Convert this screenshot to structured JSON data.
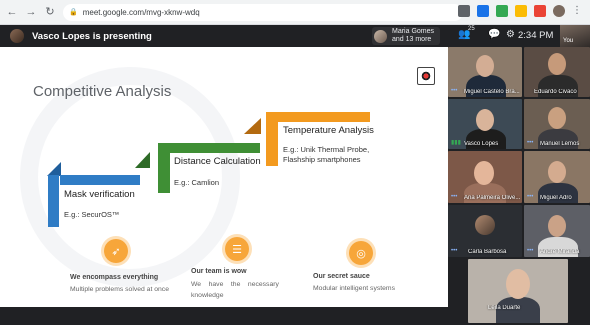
{
  "browser": {
    "url": "meet.google.com/mvg-xknw-wdq"
  },
  "meet": {
    "presenter_text": "Vasco Lopes is presenting",
    "people_chip_line1": "Maria Gomes",
    "people_chip_line2": "and 13 more",
    "people_count": "25",
    "clock": "2:34 PM",
    "you_label": "You"
  },
  "slide": {
    "title": "Competitive Analysis",
    "steps": [
      {
        "label": "Mask verification",
        "sub": "E.g.: SecurOS™",
        "color": "#2f7cc5"
      },
      {
        "label": "Distance Calculation",
        "sub": "E.g.: Camlion",
        "color": "#3f8f35"
      },
      {
        "label": "Temperature Analysis",
        "sub_line1": "E.g.: Unik Thermal Probe,",
        "sub_line2": "Flashship smartphones",
        "color": "#f39a1f"
      }
    ],
    "features": [
      {
        "title": "We encompass everything",
        "desc": "Multiple problems solved at once",
        "icon": "rocket-icon"
      },
      {
        "title": "Our team is wow",
        "desc_line1": "We    have    the    necessary",
        "desc_line2": "knowledge",
        "icon": "layers-icon"
      },
      {
        "title": "Our secret sauce",
        "desc": "Modular intelligent systems",
        "icon": "target-icon"
      }
    ]
  },
  "participants": [
    {
      "name": "Miguel Castelo Bra..."
    },
    {
      "name": "Eduardo Civaco"
    },
    {
      "name": "Vasco Lopes"
    },
    {
      "name": "Manuel Lemos"
    },
    {
      "name": "Ana Palmeira Olive..."
    },
    {
      "name": "Miguel Adro"
    },
    {
      "name": "Carla Barbosa"
    },
    {
      "name": "André Miranda"
    },
    {
      "name": "Leila Duarte"
    }
  ]
}
